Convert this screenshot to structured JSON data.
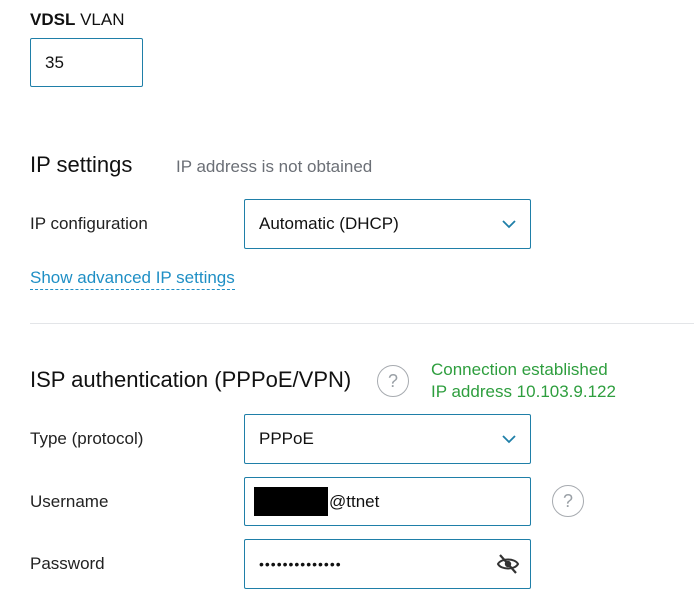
{
  "vlan": {
    "label_bold": "VDSL",
    "label_rest": " VLAN",
    "value": "35"
  },
  "ip_settings": {
    "title": "IP settings",
    "status": "IP address is not obtained",
    "config_label": "IP configuration",
    "config_value": "Automatic (DHCP)",
    "advanced_link": "Show advanced IP settings"
  },
  "isp_auth": {
    "title": "ISP authentication (PPPoE/VPN)",
    "help_icon": "question-circle-icon",
    "status_line1": "Connection established",
    "status_line2": "IP address 10.103.9.122",
    "status_color": "#2e9e3e",
    "type_label": "Type (protocol)",
    "type_value": "PPPoE",
    "username_label": "Username",
    "username_visible_suffix": "@ttnet",
    "password_label": "Password",
    "password_masked": "••••••••••••••",
    "password_toggle_icon": "eye-slash-icon"
  },
  "colors": {
    "accent": "#1f8fc5",
    "input_border": "#1f7fa8",
    "success": "#2e9e3e"
  }
}
